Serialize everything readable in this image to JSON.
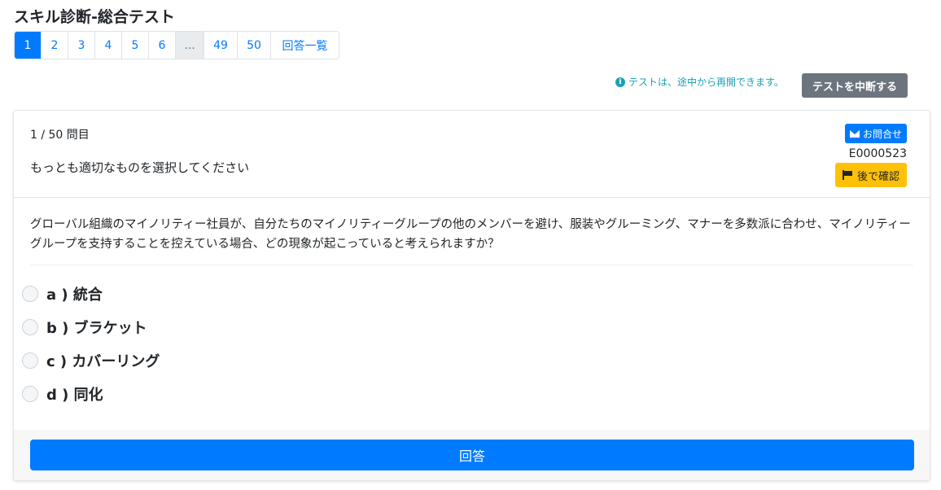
{
  "page": {
    "title": "スキル診断-総合テスト"
  },
  "pagination": {
    "items": [
      {
        "label": "1",
        "state": "active"
      },
      {
        "label": "2",
        "state": "normal"
      },
      {
        "label": "3",
        "state": "normal"
      },
      {
        "label": "4",
        "state": "normal"
      },
      {
        "label": "5",
        "state": "normal"
      },
      {
        "label": "6",
        "state": "normal"
      },
      {
        "label": "...",
        "state": "ellipsis"
      },
      {
        "label": "49",
        "state": "normal"
      },
      {
        "label": "50",
        "state": "normal"
      },
      {
        "label": "回答一覧",
        "state": "normal"
      }
    ]
  },
  "notice": {
    "icon": "info-icon",
    "text": "テストは、途中から再開できます。"
  },
  "suspend_button": {
    "label": "テストを中断する"
  },
  "question": {
    "counter": "1 / 50 問目",
    "instruction": "もっとも適切なものを選択してください",
    "contact_label": "お問合せ",
    "id": "E0000523",
    "review_label": "後で確認",
    "text": "グローバル組織のマイノリティー社員が、自分たちのマイノリティーグループの他のメンバーを避け、服装やグルーミング、マナーを多数派に合わせ、マイノリティーグループを支持することを控えている場合、どの現象が起こっていると考えられますか？",
    "options": [
      {
        "label": "a ) 統合"
      },
      {
        "label": "b ) ブラケット"
      },
      {
        "label": "c ) カバーリング"
      },
      {
        "label": "d ) 同化"
      }
    ]
  },
  "answer_button": {
    "label": "回答"
  },
  "colors": {
    "primary": "#007bff",
    "secondary": "#6c757d",
    "warning": "#ffc107",
    "info": "#17a2b8"
  }
}
